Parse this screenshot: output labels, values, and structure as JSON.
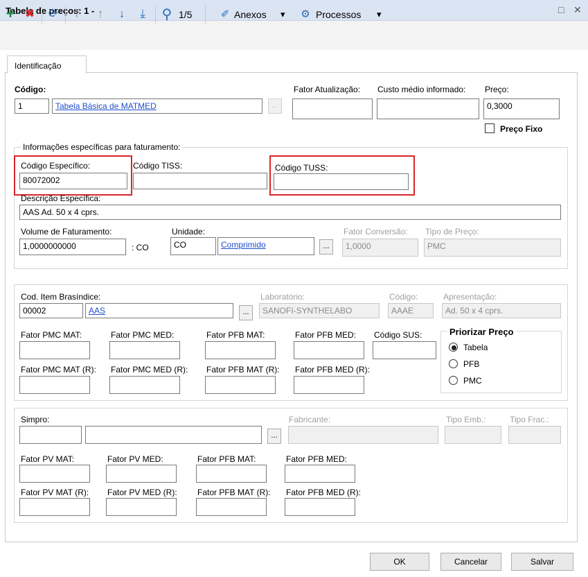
{
  "window": {
    "title": "Tabela de preços: 1 -",
    "restore_glyph": "□",
    "close_glyph": "✕"
  },
  "toolbar": {
    "icons": [
      "plus-icon",
      "delete-icon",
      "refresh-icon",
      "first-icon",
      "up-icon",
      "down-icon",
      "last-icon",
      "search-icon"
    ],
    "glyphs": {
      "add": "+",
      "delete": "✖",
      "refresh": "⟳",
      "first": "⤒",
      "prev": "↑",
      "next": "↓",
      "last": "⤓",
      "search": "⚲"
    },
    "pager": "1/5",
    "anexos_label": "Anexos",
    "processos_label": "Processos",
    "caret": "▾"
  },
  "tab": {
    "label": "Identificação"
  },
  "main": {
    "codigo_label": "Código:",
    "codigo_value": "1",
    "tabela_link": "Tabela Básica de MATMED",
    "fator_atualizacao_label": "Fator Atualização:",
    "custo_medio_label": "Custo médio informado:",
    "preco_label": "Preço:",
    "preco_value": "0,3000",
    "preco_fixo_label": "Preço Fixo",
    "dots": "..."
  },
  "faturamento": {
    "group_label": "Informações específicas para faturamento:",
    "codigo_especifico_label": "Código Específico:",
    "codigo_especifico_value": "80072002",
    "codigo_tiss_label": "Código TISS:",
    "codigo_tuss_label": "Código TUSS:",
    "descricao_label": "Descrição Específica:",
    "descricao_value": "AAS Ad. 50 x 4 cprs.",
    "volume_label": "Volume de Faturamento:",
    "volume_value": "1,0000000000",
    "volume_unit": ": CO",
    "unidade_label": "Unidade:",
    "unidade_code": "CO",
    "unidade_link": "Comprimido",
    "fator_conversao_label": "Fator Conversão:",
    "fator_conversao_value": "1,0000",
    "tipo_preco_label": "Tipo de Preço:",
    "tipo_preco_value": "PMC"
  },
  "brasindice": {
    "cod_item_label": "Cod. Item Brasíndice:",
    "cod_item_value": "00002",
    "item_link": "AAS",
    "laboratorio_label": "Laboratório:",
    "laboratorio_value": "SANOFI-SYNTHELABO",
    "codigo_label": "Código:",
    "codigo_value": "AAAE",
    "apresentacao_label": "Apresentação:",
    "apresentacao_value": "Ad. 50 x 4 cprs.",
    "fator_pmc_mat": "Fator PMC MAT:",
    "fator_pmc_med": "Fator PMC MED:",
    "fator_pfb_mat": "Fator PFB MAT:",
    "fator_pfb_med": "Fator PFB MED:",
    "codigo_sus": "Código SUS:",
    "fator_pmc_mat_r": "Fator PMC MAT (R):",
    "fator_pmc_med_r": "Fator PMC MED (R):",
    "fator_pfb_mat_r": "Fator PFB MAT (R):",
    "fator_pfb_med_r": "Fator PFB MED (R):",
    "priorizar_label": "Priorizar Preço",
    "priorizar_options": [
      "Tabela",
      "PFB",
      "PMC"
    ],
    "priorizar_selected": "Tabela"
  },
  "simpro": {
    "simpro_label": "Simpro:",
    "fabricante_label": "Fabricante:",
    "tipo_emb_label": "Tipo Emb.:",
    "tipo_frac_label": "Tipo Frac.:",
    "fator_pv_mat": "Fator PV MAT:",
    "fator_pv_med": "Fator PV MED:",
    "fator_pfb_mat": "Fator PFB MAT:",
    "fator_pfb_med": "Fator PFB MED:",
    "fator_pv_mat_r": "Fator PV MAT (R):",
    "fator_pv_med_r": "Fator PV MED (R):",
    "fator_pfb_mat_r": "Fator PFB MAT (R):",
    "fator_pfb_med_r": "Fator PFB MED (R):"
  },
  "buttons": {
    "ok": "OK",
    "cancelar": "Cancelar",
    "salvar": "Salvar"
  },
  "colors": {
    "highlight": "#d9262b",
    "link": "#1f4fcc",
    "add_icon": "#1f8a4a",
    "delete_icon": "#d9262b",
    "toolbar_icon": "#2a6fb8"
  }
}
